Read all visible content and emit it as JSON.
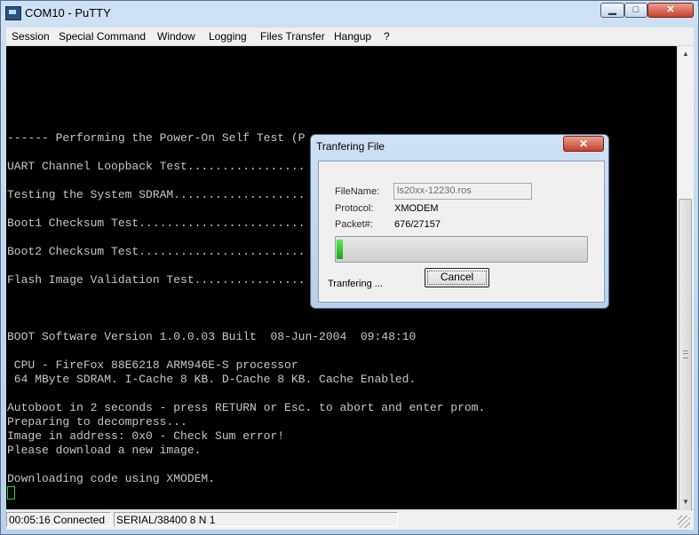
{
  "window": {
    "title": "COM10 - PuTTY",
    "app_icon": "putty-icon"
  },
  "window_controls": {
    "minimize": "▁",
    "maximize": "□",
    "close": "✕"
  },
  "menu": [
    "Session",
    "Special Command",
    "Window",
    "Logging",
    "Files Transfer",
    "Hangup",
    "?"
  ],
  "terminal": {
    "lines": [
      "------ Performing the Power-On Self Test (P",
      "UART Channel Loopback Test.................",
      "Testing the System SDRAM...................",
      "Boot1 Checksum Test........................",
      "Boot2 Checksum Test........................",
      "Flash Image Validation Test................",
      "BOOT Software Version 1.0.0.03 Built  08-Jun-2004  09:48:10",
      " CPU - FireFox 88E6218 ARM946E-S processor",
      " 64 MByte SDRAM. I-Cache 8 KB. D-Cache 8 KB. Cache Enabled.",
      "Autoboot in 2 seconds - press RETURN or Esc. to abort and enter prom.",
      "Preparing to decompress...",
      "Image in address: 0x0 - Check Sum error!",
      "Please download a new image.",
      "Downloading code using XMODEM."
    ],
    "cursor_color": "#31d131"
  },
  "status": {
    "time": "00:05:16 Connected",
    "port": "SERIAL/38400 8 N 1"
  },
  "dialog": {
    "title": "Tranfering File",
    "close": "✕",
    "filename_label": "FileName:",
    "filename_value": "ls20xx-12230.ros",
    "protocol_label": "Protocol:",
    "protocol_value": "XMODEM",
    "packet_label": "Packet#:",
    "packet_value": "676/27157",
    "progress_fraction": 0.0249,
    "status_text": "Tranfering ...",
    "cancel_label": "Cancel"
  },
  "colors": {
    "terminal_bg": "#000000",
    "terminal_fg": "#c6c6c6",
    "progress": "#1fb81f"
  }
}
